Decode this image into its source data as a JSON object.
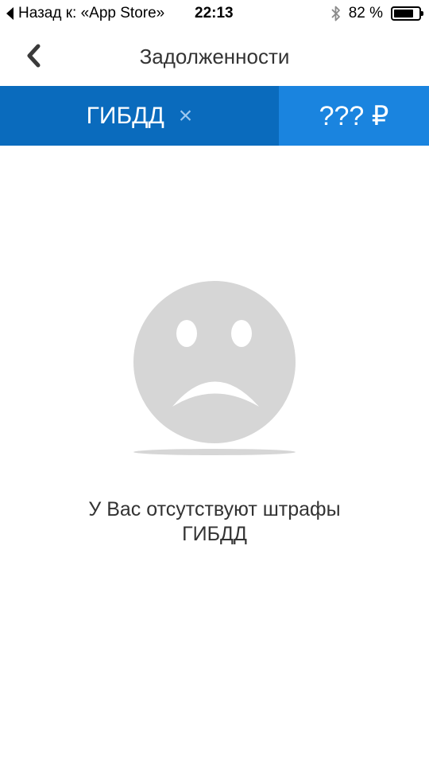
{
  "status_bar": {
    "back_label": "Назад к: «App Store»",
    "time": "22:13",
    "battery_text": "82 %",
    "battery_level": 0.82,
    "bluetooth_icon": "bluetooth-icon",
    "battery_icon": "battery-icon"
  },
  "nav": {
    "title": "Задолженности",
    "back_icon": "chevron-left-icon"
  },
  "tabs": {
    "gibdd_label": "ГИБДД",
    "close_symbol": "×",
    "amount_label": "??? ₽"
  },
  "empty_state": {
    "icon": "sad-face-icon",
    "message_line1": "У Вас отсутствуют штрафы",
    "message_line2": "ГИБДД"
  },
  "colors": {
    "tab_active": "#0a6bbd",
    "tab_amount": "#1a84df",
    "face": "#d6d6d6"
  }
}
